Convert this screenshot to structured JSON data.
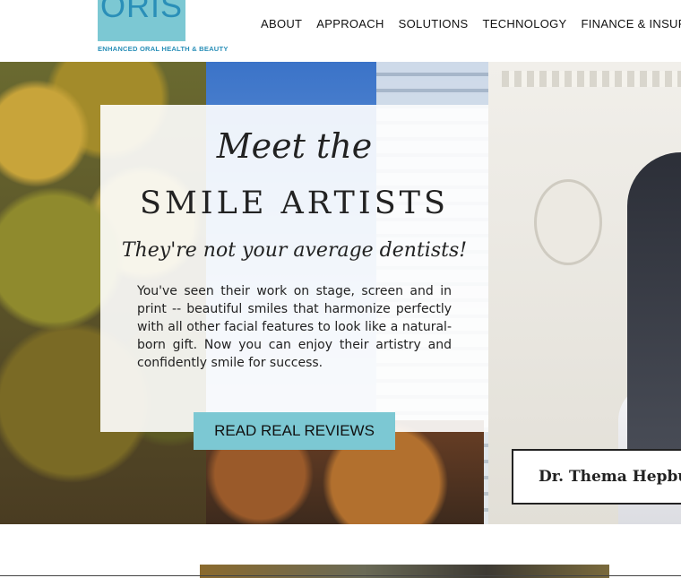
{
  "header": {
    "logo_text": "ORIS",
    "logo_tagline": "ENHANCED ORAL HEALTH & BEAUTY",
    "nav": [
      "ABOUT",
      "APPROACH",
      "SOLUTIONS",
      "TECHNOLOGY",
      "FINANCE & INSURANCE"
    ]
  },
  "hero": {
    "meet": "Meet the",
    "title": "SMILE ARTISTS",
    "subtitle": "They're not your average dentists!",
    "body": "You've seen their work on stage, screen and in print -- beautiful smiles that harmonize perfectly with all other facial features to look like a natural-born gift. Now you can enjoy their artistry and confidently smile for success.",
    "cta_label": "READ REAL REVIEWS",
    "doctor_name": "Dr. Thema Hepburn"
  },
  "colors": {
    "accent": "#7cc8d3",
    "logo_text": "#2a8fb8"
  }
}
